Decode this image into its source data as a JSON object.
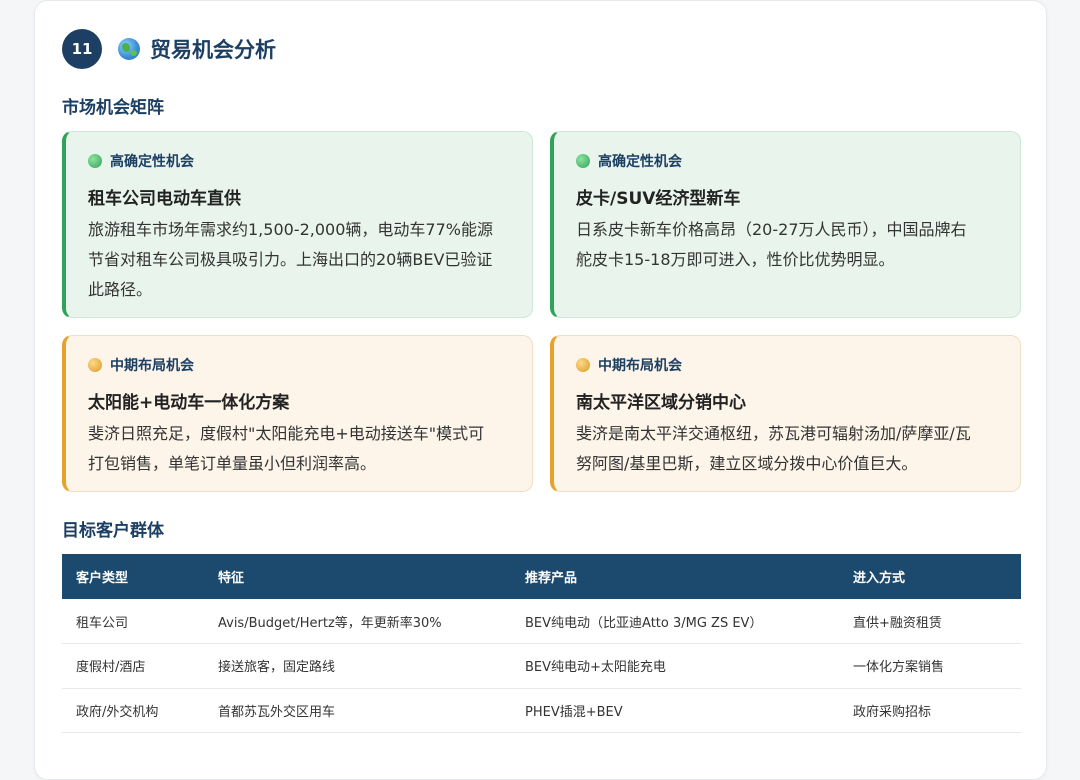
{
  "header": {
    "section_number": "11",
    "icon": "globe-icon",
    "title": "贸易机会分析"
  },
  "matrix": {
    "title": "市场机会矩阵",
    "cards": [
      {
        "tag": "高确定性机会",
        "title": "租车公司电动车直供",
        "lines": [
          "旅游租车市场年需求约1,500-2,000辆，电动车77%能源",
          "节省对租车公司极具吸引力。上海出口的20辆BEV已验证",
          "此路径。"
        ]
      },
      {
        "tag": "高确定性机会",
        "title": "皮卡/SUV经济型新车",
        "lines": [
          "日系皮卡新车价格高昂（20-27万人民币），中国品牌右",
          "舵皮卡15-18万即可进入，性价比优势明显。"
        ]
      },
      {
        "tag": "中期布局机会",
        "title": "太阳能+电动车一体化方案",
        "lines": [
          "斐济日照充足，度假村\"太阳能充电+电动接送车\"模式可",
          "打包销售，单笔订单量虽小但利润率高。"
        ]
      },
      {
        "tag": "中期布局机会",
        "title": "南太平洋区域分销中心",
        "lines": [
          "斐济是南太平洋交通枢纽，苏瓦港可辐射汤加/萨摩亚/瓦",
          "努阿图/基里巴斯，建立区域分拨中心价值巨大。"
        ]
      }
    ],
    "colors": {
      "high": "#2fa35a",
      "mid": "#e8a22b"
    }
  },
  "clients": {
    "title": "目标客户群体",
    "columns": [
      "客户类型",
      "特征",
      "推荐产品",
      "进入方式"
    ],
    "rows": [
      [
        "租车公司",
        "Avis/Budget/Hertz等，年更新率30%",
        "BEV纯电动（比亚迪Atto 3/MG ZS EV）",
        "直供+融资租赁"
      ],
      [
        "度假村/酒店",
        "接送旅客，固定路线",
        "BEV纯电动+太阳能充电",
        "一体化方案销售"
      ],
      [
        "政府/外交机构",
        "首都苏瓦外交区用车",
        "PHEV插混+BEV",
        "政府采购招标"
      ]
    ]
  }
}
